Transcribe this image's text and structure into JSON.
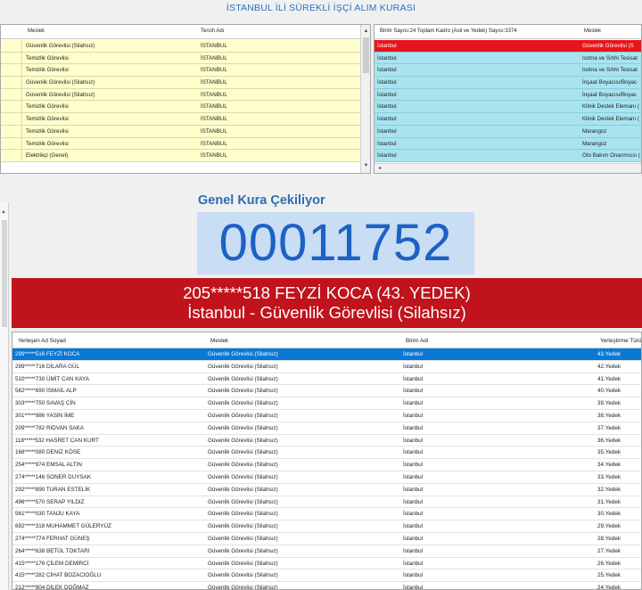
{
  "title": "İSTANBUL İLİ SÜREKLİ İŞÇİ ALIM KURASI",
  "top_left": {
    "columns": [
      "Meslek",
      "Tercih Adı"
    ],
    "rows": [
      {
        "meslek": "Güvenlik Görevlisi (Silahsız)",
        "tercih": "İSTANBUL"
      },
      {
        "meslek": "Temizlik Görevlisi",
        "tercih": "İSTANBUL"
      },
      {
        "meslek": "Temizlik Görevlisi",
        "tercih": "İSTANBUL"
      },
      {
        "meslek": "Güvenlik Görevlisi (Silahsız)",
        "tercih": "İSTANBUL"
      },
      {
        "meslek": "Güvenlik Görevlisi (Silahsız)",
        "tercih": "İSTANBUL"
      },
      {
        "meslek": "Temizlik Görevlisi",
        "tercih": "İSTANBUL"
      },
      {
        "meslek": "Temizlik Görevlisi",
        "tercih": "İSTANBUL"
      },
      {
        "meslek": "Temizlik Görevlisi",
        "tercih": "İSTANBUL"
      },
      {
        "meslek": "Temizlik Görevlisi",
        "tercih": "İSTANBUL"
      },
      {
        "meslek": "Elektrikçi (Genel)",
        "tercih": "İSTANBUL"
      }
    ]
  },
  "top_right": {
    "header_info": "Birim Sayısı:24 Toplam Kadro (Asil ve Yedek) Sayısı:3374",
    "header_meslek": "Meslek",
    "rows": [
      {
        "birim": "İstanbul",
        "meslek": "Güvenlik Görevlisi (S"
      },
      {
        "birim": "İstanbul",
        "meslek": "Isıtma ve Sıhhi Tesisat"
      },
      {
        "birim": "İstanbul",
        "meslek": "Isıtma ve Sıhhi Tesisat"
      },
      {
        "birim": "İstanbul",
        "meslek": "İnşaat Boyacısı/Boyac"
      },
      {
        "birim": "İstanbul",
        "meslek": "İnşaat Boyacısı/Boyac"
      },
      {
        "birim": "İstanbul",
        "meslek": "Klinik Destek Elemanı ("
      },
      {
        "birim": "İstanbul",
        "meslek": "Klinik Destek Elemanı ("
      },
      {
        "birim": "İstanbul",
        "meslek": "Marangoz"
      },
      {
        "birim": "İstanbul",
        "meslek": "Marangoz"
      },
      {
        "birim": "İstanbul",
        "meslek": "Oto Bakım Onarımcısı ("
      }
    ]
  },
  "draw": {
    "label": "Genel Kura Çekiliyor",
    "number": "00011752",
    "winner_line1": "205*****518 FEYZİ KOCA (43. YEDEK)",
    "winner_line2": "İstanbul - Güvenlik Görevlisi (Silahsız)"
  },
  "bottom": {
    "columns": [
      "Yerleşen Ad Soyad",
      "Meslek",
      "Birim Adı",
      "Yerleştirme Türü"
    ],
    "rows": [
      {
        "name": "299*****516 FEYZİ KOCA",
        "meslek": "Güvenlik Görevlisi (Silahsız)",
        "birim": "İstanbul",
        "tur": "43.Yedek"
      },
      {
        "name": "299*****716 DİLARA GÜL",
        "meslek": "Güvenlik Görevlisi (Silahsız)",
        "birim": "İstanbul",
        "tur": "42.Yedek"
      },
      {
        "name": "510*****730 ÜMİT CAN KAYA",
        "meslek": "Güvenlik Görevlisi (Silahsız)",
        "birim": "İstanbul",
        "tur": "41.Yedek"
      },
      {
        "name": "562*****690 İSMAİL ALP",
        "meslek": "Güvenlik Görevlisi (Silahsız)",
        "birim": "İstanbul",
        "tur": "40.Yedek"
      },
      {
        "name": "303*****750 SAVAŞ CİN",
        "meslek": "Güvenlik Görevlisi (Silahsız)",
        "birim": "İstanbul",
        "tur": "39.Yedek"
      },
      {
        "name": "301*****986 YASİN İME",
        "meslek": "Güvenlik Görevlisi (Silahsız)",
        "birim": "İstanbul",
        "tur": "38.Yedek"
      },
      {
        "name": "209*****782 RIDVAN SAKA",
        "meslek": "Güvenlik Görevlisi (Silahsız)",
        "birim": "İstanbul",
        "tur": "37.Yedek"
      },
      {
        "name": "118*****532 HASRET CAN KURT",
        "meslek": "Güvenlik Görevlisi (Silahsız)",
        "birim": "İstanbul",
        "tur": "36.Yedek"
      },
      {
        "name": "168*****080 DENİZ KÖSE",
        "meslek": "Güvenlik Görevlisi (Silahsız)",
        "birim": "İstanbul",
        "tur": "35.Yedek"
      },
      {
        "name": "254*****974 EMSAL ALTIN",
        "meslek": "Güvenlik Görevlisi (Silahsız)",
        "birim": "İstanbul",
        "tur": "34.Yedek"
      },
      {
        "name": "274*****146 SONER DUYSAK",
        "meslek": "Güvenlik Görevlisi (Silahsız)",
        "birim": "İstanbul",
        "tur": "33.Yedek"
      },
      {
        "name": "292*****890 TURAN ESTELİK",
        "meslek": "Güvenlik Görevlisi (Silahsız)",
        "birim": "İstanbul",
        "tur": "32.Yedek"
      },
      {
        "name": "496*****570 SERAP YILDIZ",
        "meslek": "Güvenlik Görevlisi (Silahsız)",
        "birim": "İstanbul",
        "tur": "31.Yedek"
      },
      {
        "name": "561*****030 TANJU KAYA",
        "meslek": "Güvenlik Görevlisi (Silahsız)",
        "birim": "İstanbul",
        "tur": "30.Yedek"
      },
      {
        "name": "692*****318 MUHAMMET GÜLERYÜZ",
        "meslek": "Güvenlik Görevlisi (Silahsız)",
        "birim": "İstanbul",
        "tur": "29.Yedek"
      },
      {
        "name": "274*****774 FERHAT GÜNEŞ",
        "meslek": "Güvenlik Görevlisi (Silahsız)",
        "birim": "İstanbul",
        "tur": "28.Yedek"
      },
      {
        "name": "264*****638 BETÜL TOKTARI",
        "meslek": "Güvenlik Görevlisi (Silahsız)",
        "birim": "İstanbul",
        "tur": "27.Yedek"
      },
      {
        "name": "415*****176 ÇİLEM DEMİRCİ",
        "meslek": "Güvenlik Görevlisi (Silahsız)",
        "birim": "İstanbul",
        "tur": "26.Yedek"
      },
      {
        "name": "415*****282 CİHAT BOZACIOĞLU",
        "meslek": "Güvenlik Görevlisi (Silahsız)",
        "birim": "İstanbul",
        "tur": "25.Yedek"
      },
      {
        "name": "212*****904 DİLEK DOĞMAZ",
        "meslek": "Güvenlik Görevlisi (Silahsız)",
        "birim": "İstanbul",
        "tur": "24.Yedek"
      }
    ]
  }
}
